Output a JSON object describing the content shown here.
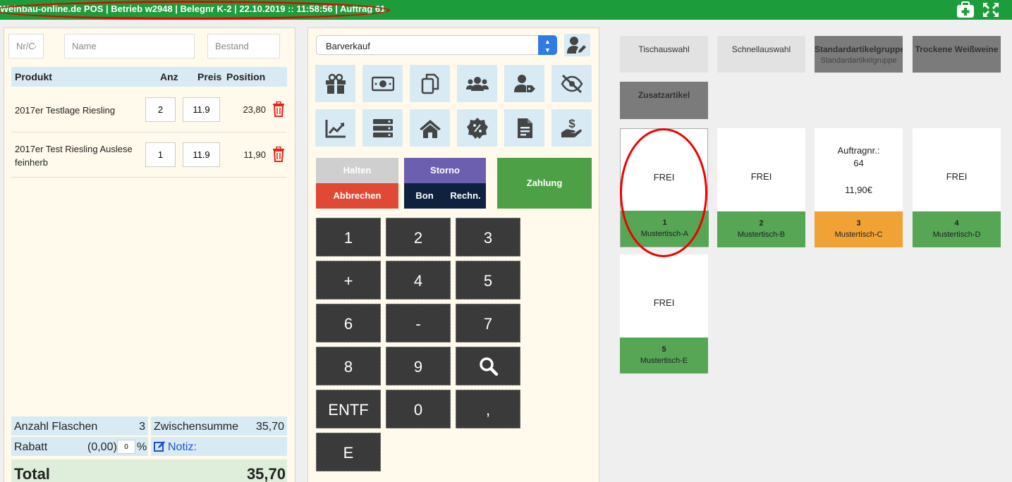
{
  "header": {
    "title": "Weinbau-online.de POS | Betrieb w2948 | Belegnr K-2 | 22.10.2019 :: 11:58:56 | Auftrag 61",
    "icons": [
      "first-aid-kit-icon",
      "fullscreen-expand-icon"
    ]
  },
  "filters": {
    "code_placeholder": "Nr/Code",
    "name_placeholder": "Name",
    "stock_placeholder": "Bestand"
  },
  "cart": {
    "columns": {
      "product": "Produkt",
      "qty": "Anz",
      "price": "Preis",
      "position": "Position"
    },
    "items": [
      {
        "name": "2017er Testlage Riesling",
        "qty": "2",
        "price": "11.9",
        "position": "23,80"
      },
      {
        "name": "2017er Test Riesling Auslese feinherb",
        "qty": "1",
        "price": "11.9",
        "position": "11,90"
      }
    ]
  },
  "summary": {
    "bottles_label": "Anzahl Flaschen",
    "bottles_value": "3",
    "subtotal_label": "Zwischensumme",
    "subtotal_value": "35,70",
    "discount_label": "Rabatt",
    "discount_value": "(0,00)",
    "discount_percent": "0",
    "percent_sign": "%",
    "note_label": "Notiz:",
    "total_label": "Total",
    "total_value": "35,70"
  },
  "pos": {
    "sale_type": "Barverkauf",
    "actions": {
      "hold": "Halten",
      "cancel": "Abbrechen",
      "storno": "Storno",
      "bon": "Bon",
      "invoice": "Rechn.",
      "pay": "Zahlung"
    },
    "keys": [
      "1",
      "2",
      "3",
      "+",
      "4",
      "5",
      "6",
      "-",
      "7",
      "8",
      "9",
      "ENTF",
      "0",
      ",",
      "E"
    ]
  },
  "categories": [
    {
      "label": "Tischauswahl",
      "sub": ""
    },
    {
      "label": "Schnellauswahl",
      "sub": ""
    },
    {
      "label": "Standardartikelgruppe",
      "sub": "Standardartikelgruppe"
    },
    {
      "label": "Trockene Weißweine",
      "sub": ""
    },
    {
      "label": "Zusatzartikel",
      "sub": ""
    }
  ],
  "tables": [
    {
      "status": "FREI",
      "number": "1",
      "name": "Mustertisch-A",
      "color": "#56a656"
    },
    {
      "status": "FREI",
      "number": "2",
      "name": "Mustertisch-B",
      "color": "#56a656"
    },
    {
      "status_line1": "Auftragnr.:",
      "status_line2": "64",
      "amount": "11,90€",
      "number": "3",
      "name": "Mustertisch-C",
      "color": "#f0a235"
    },
    {
      "status": "FREI",
      "number": "4",
      "name": "Mustertisch-D",
      "color": "#56a656"
    },
    {
      "status": "FREI",
      "number": "5",
      "name": "Mustertisch-E",
      "color": "#56a656"
    }
  ],
  "colors": {
    "topbar": "#1c9c3a",
    "hold": "#cfcfcf",
    "cancel": "#e04a35",
    "storno": "#6c5fb0",
    "bon": "#0e2240",
    "pay": "#4ea047",
    "occupied": "#f0a235",
    "free": "#56a656",
    "annotation": "#ee0000"
  }
}
